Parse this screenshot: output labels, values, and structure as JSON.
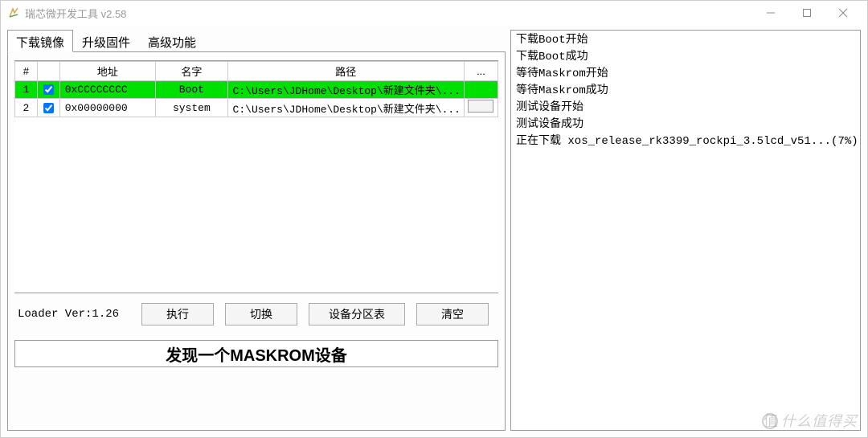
{
  "window": {
    "title": "瑞芯微开发工具 v2.58"
  },
  "tabs": {
    "download": "下载镜像",
    "upgrade": "升级固件",
    "advanced": "高级功能"
  },
  "table": {
    "headers": {
      "idx": "#",
      "chk": "",
      "addr": "地址",
      "name": "名字",
      "path": "路径",
      "more": "..."
    },
    "rows": [
      {
        "idx": "1",
        "checked": true,
        "addr": "0xCCCCCCCC",
        "name": "Boot",
        "path": "C:\\Users\\JDHome\\Desktop\\新建文件夹\\...",
        "highlighted": true,
        "browse": false
      },
      {
        "idx": "2",
        "checked": true,
        "addr": "0x00000000",
        "name": "system",
        "path": "C:\\Users\\JDHome\\Desktop\\新建文件夹\\...",
        "highlighted": false,
        "browse": true
      }
    ]
  },
  "footer": {
    "loader_ver": "Loader Ver:1.26",
    "buttons": {
      "execute": "执行",
      "switch": "切换",
      "partition": "设备分区表",
      "clear": "清空"
    }
  },
  "status_bar": "发现一个MASKROM设备",
  "log": [
    "下载Boot开始",
    "下载Boot成功",
    "等待Maskrom开始",
    "等待Maskrom成功",
    "测试设备开始",
    "测试设备成功",
    "正在下载 xos_release_rk3399_rockpi_3.5lcd_v51...(7%)"
  ],
  "watermark": "什么值得买"
}
